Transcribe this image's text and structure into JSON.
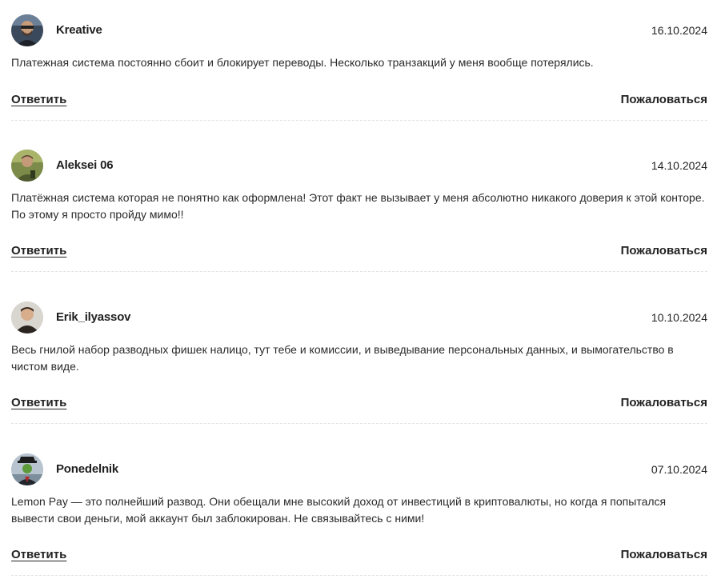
{
  "reviews": [
    {
      "author": "Kreative",
      "date": "16.10.2024",
      "text": "Платежная система постоянно сбоит и блокирует переводы. Несколько транзакций у меня вообще потерялись.",
      "reply_label": "Ответить",
      "report_label": "Пожаловаться"
    },
    {
      "author": "Aleksei 06",
      "date": "14.10.2024",
      "text": "Платёжная система которая не понятно как оформлена! Этот факт не вызывает у меня абсолютно никакого доверия к этой конторе. По этому я просто пройду мимо!!",
      "reply_label": "Ответить",
      "report_label": "Пожаловаться"
    },
    {
      "author": "Erik_ilyassov",
      "date": "10.10.2024",
      "text": "Весь гнилой набор разводных фишек налицо, тут тебе и комиссии, и выведывание персональных данных, и вымогательство в чистом виде.",
      "reply_label": "Ответить",
      "report_label": "Пожаловаться"
    },
    {
      "author": "Ponedelnik",
      "date": "07.10.2024",
      "text": "Lemon Pay — это полнейший развод. Они обещали мне высокий доход от инвестиций в криптовалюты, но когда я попытался вывести свои деньги, мой аккаунт был заблокирован. Не связывайтесь с ними!",
      "reply_label": "Ответить",
      "report_label": "Пожаловаться"
    }
  ]
}
